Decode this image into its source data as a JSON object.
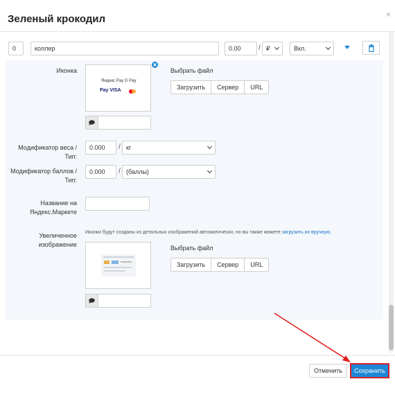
{
  "dialog": {
    "title": "Зеленый крокодил",
    "close_glyph": "×"
  },
  "option_row": {
    "position_value": "0",
    "name_value": "коллер",
    "price_value": "0.00",
    "currency": "₽",
    "status": "Вкл."
  },
  "icon_section": {
    "label": "Иконка",
    "choose_file": "Выбрать файл",
    "buttons": [
      "Загрузить",
      "Сервер",
      "URL"
    ],
    "image_lines": [
      "Яндекс Pay  G Pay",
      " Pay  VISA"
    ]
  },
  "weight_modifier": {
    "label": "Модификатор веса / Тип:",
    "value": "0.000",
    "unit": "кг"
  },
  "points_modifier": {
    "label_line1": "Модификатор баллов /",
    "label_line2": "Тип:",
    "value": "0.000",
    "unit": "(баллы)"
  },
  "yandex_name": {
    "label_line1": "Название на",
    "label_line2": "Яндекс.Маркете",
    "value": ""
  },
  "enlarged_section": {
    "label_line1": "Увеличенное",
    "label_line2": "изображение",
    "note_text": "Иконки будут созданы из детальных изображений автоматически, но вы также можете ",
    "note_link": "загрузить их вручную",
    "note_end": ".",
    "choose_file": "Выбрать файл",
    "buttons": [
      "Загрузить",
      "Сервер",
      "URL"
    ]
  },
  "footer": {
    "cancel_label": "Отменить",
    "save_label": "Сохранить"
  },
  "colors": {
    "accent": "#1e88d6",
    "highlight_border": "#d6202a",
    "annotation_arrow": "#e0201c"
  }
}
